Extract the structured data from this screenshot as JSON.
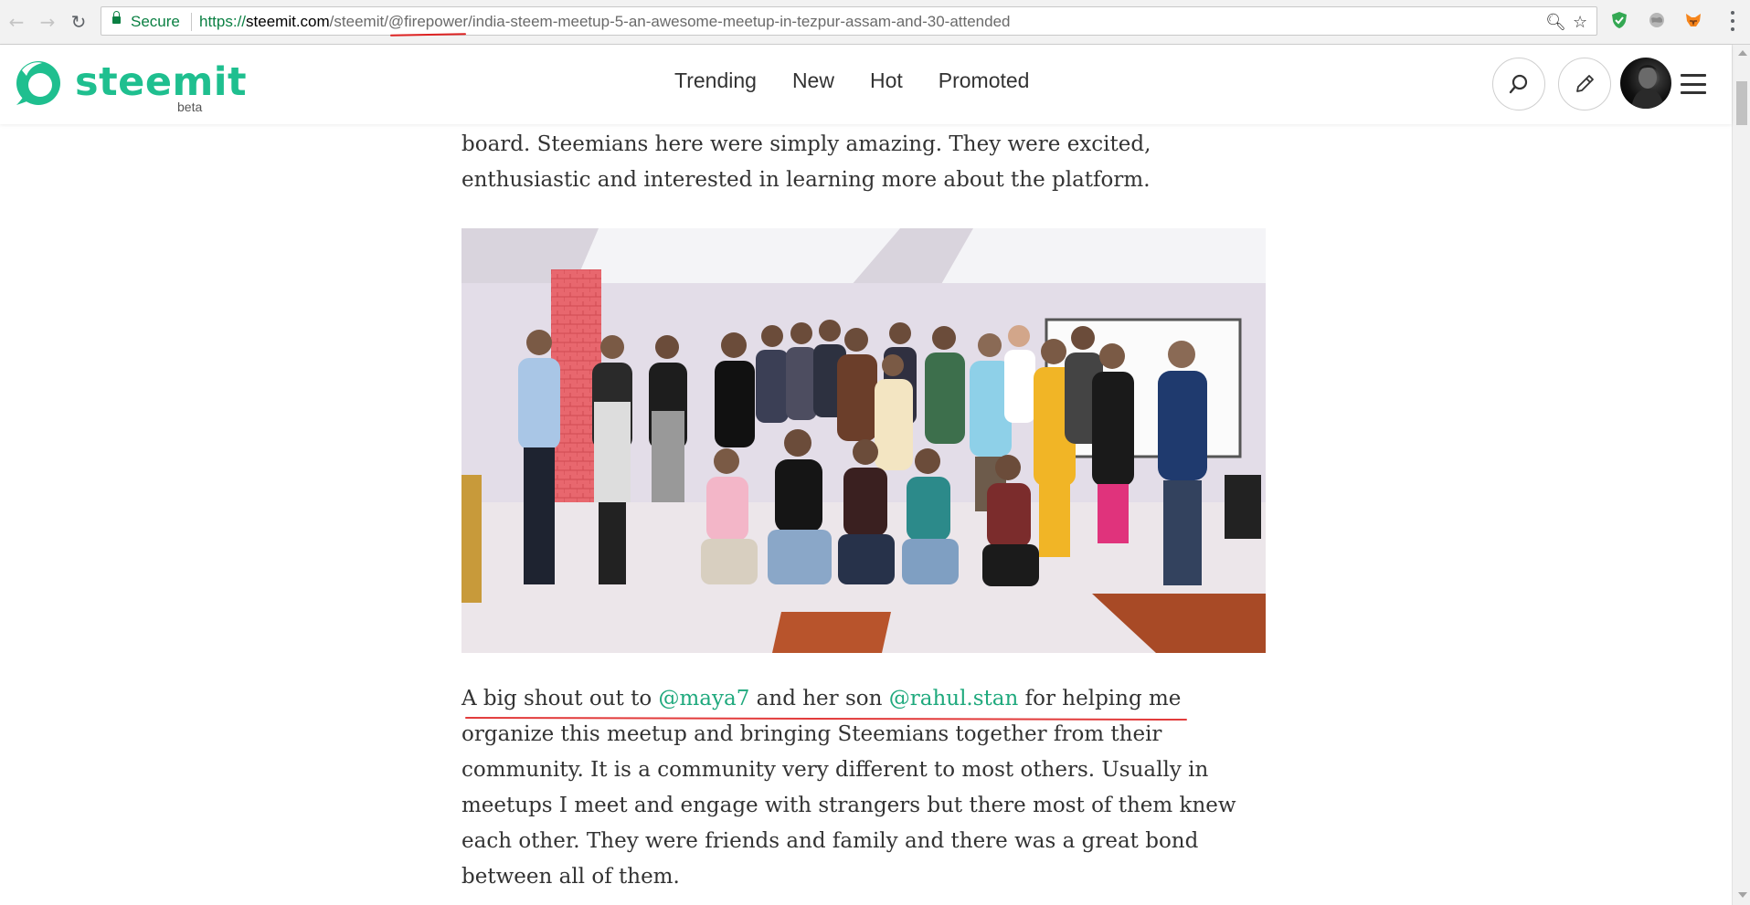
{
  "browser": {
    "secure_label": "Secure",
    "url_scheme": "https://",
    "url_host": "steemit.com",
    "url_path_before": "/steemit/",
    "url_highlight": "@firepower",
    "url_path_after": "/india-steem-meetup-5-an-awesome-meetup-in-tezpur-assam-and-30-attended",
    "nav_icons": [
      "back-arrow",
      "forward-arrow",
      "reload"
    ],
    "omnibox_icons": [
      "zoom-icon",
      "bookmark-star-icon"
    ],
    "extension_icons": [
      "shield-extension",
      "globe-extension",
      "fox-extension"
    ],
    "colors": {
      "secure": "#0b8043",
      "annotation": "#e23b3b"
    }
  },
  "site": {
    "logo_text": "steemit",
    "logo_badge": "beta",
    "nav": [
      "Trending",
      "New",
      "Hot",
      "Promoted"
    ],
    "actions": [
      "search-icon",
      "pencil-icon",
      "avatar",
      "hamburger-icon"
    ],
    "brand_color": "#1fbf8f"
  },
  "article": {
    "para1_lines": [
      "board. Steemians here were simply amazing. They were excited,",
      "enthusiastic and interested in learning more about the platform."
    ],
    "photo_caption": "",
    "para2": {
      "intro": "A big shout out to ",
      "mention1": "@maya7",
      "mid": " and her son ",
      "mention2": "@rahul.stan",
      "rest_first_line": " for helping me",
      "lines": [
        "organize this meetup and bringing Steemians together from their",
        "community. It is a community very different to most others. Usually in",
        "meetups I meet and engage with strangers but there most of them knew",
        "each other. They were friends and family and there was a great bond",
        "between all of them."
      ]
    },
    "link_color": "#1fa97d"
  }
}
